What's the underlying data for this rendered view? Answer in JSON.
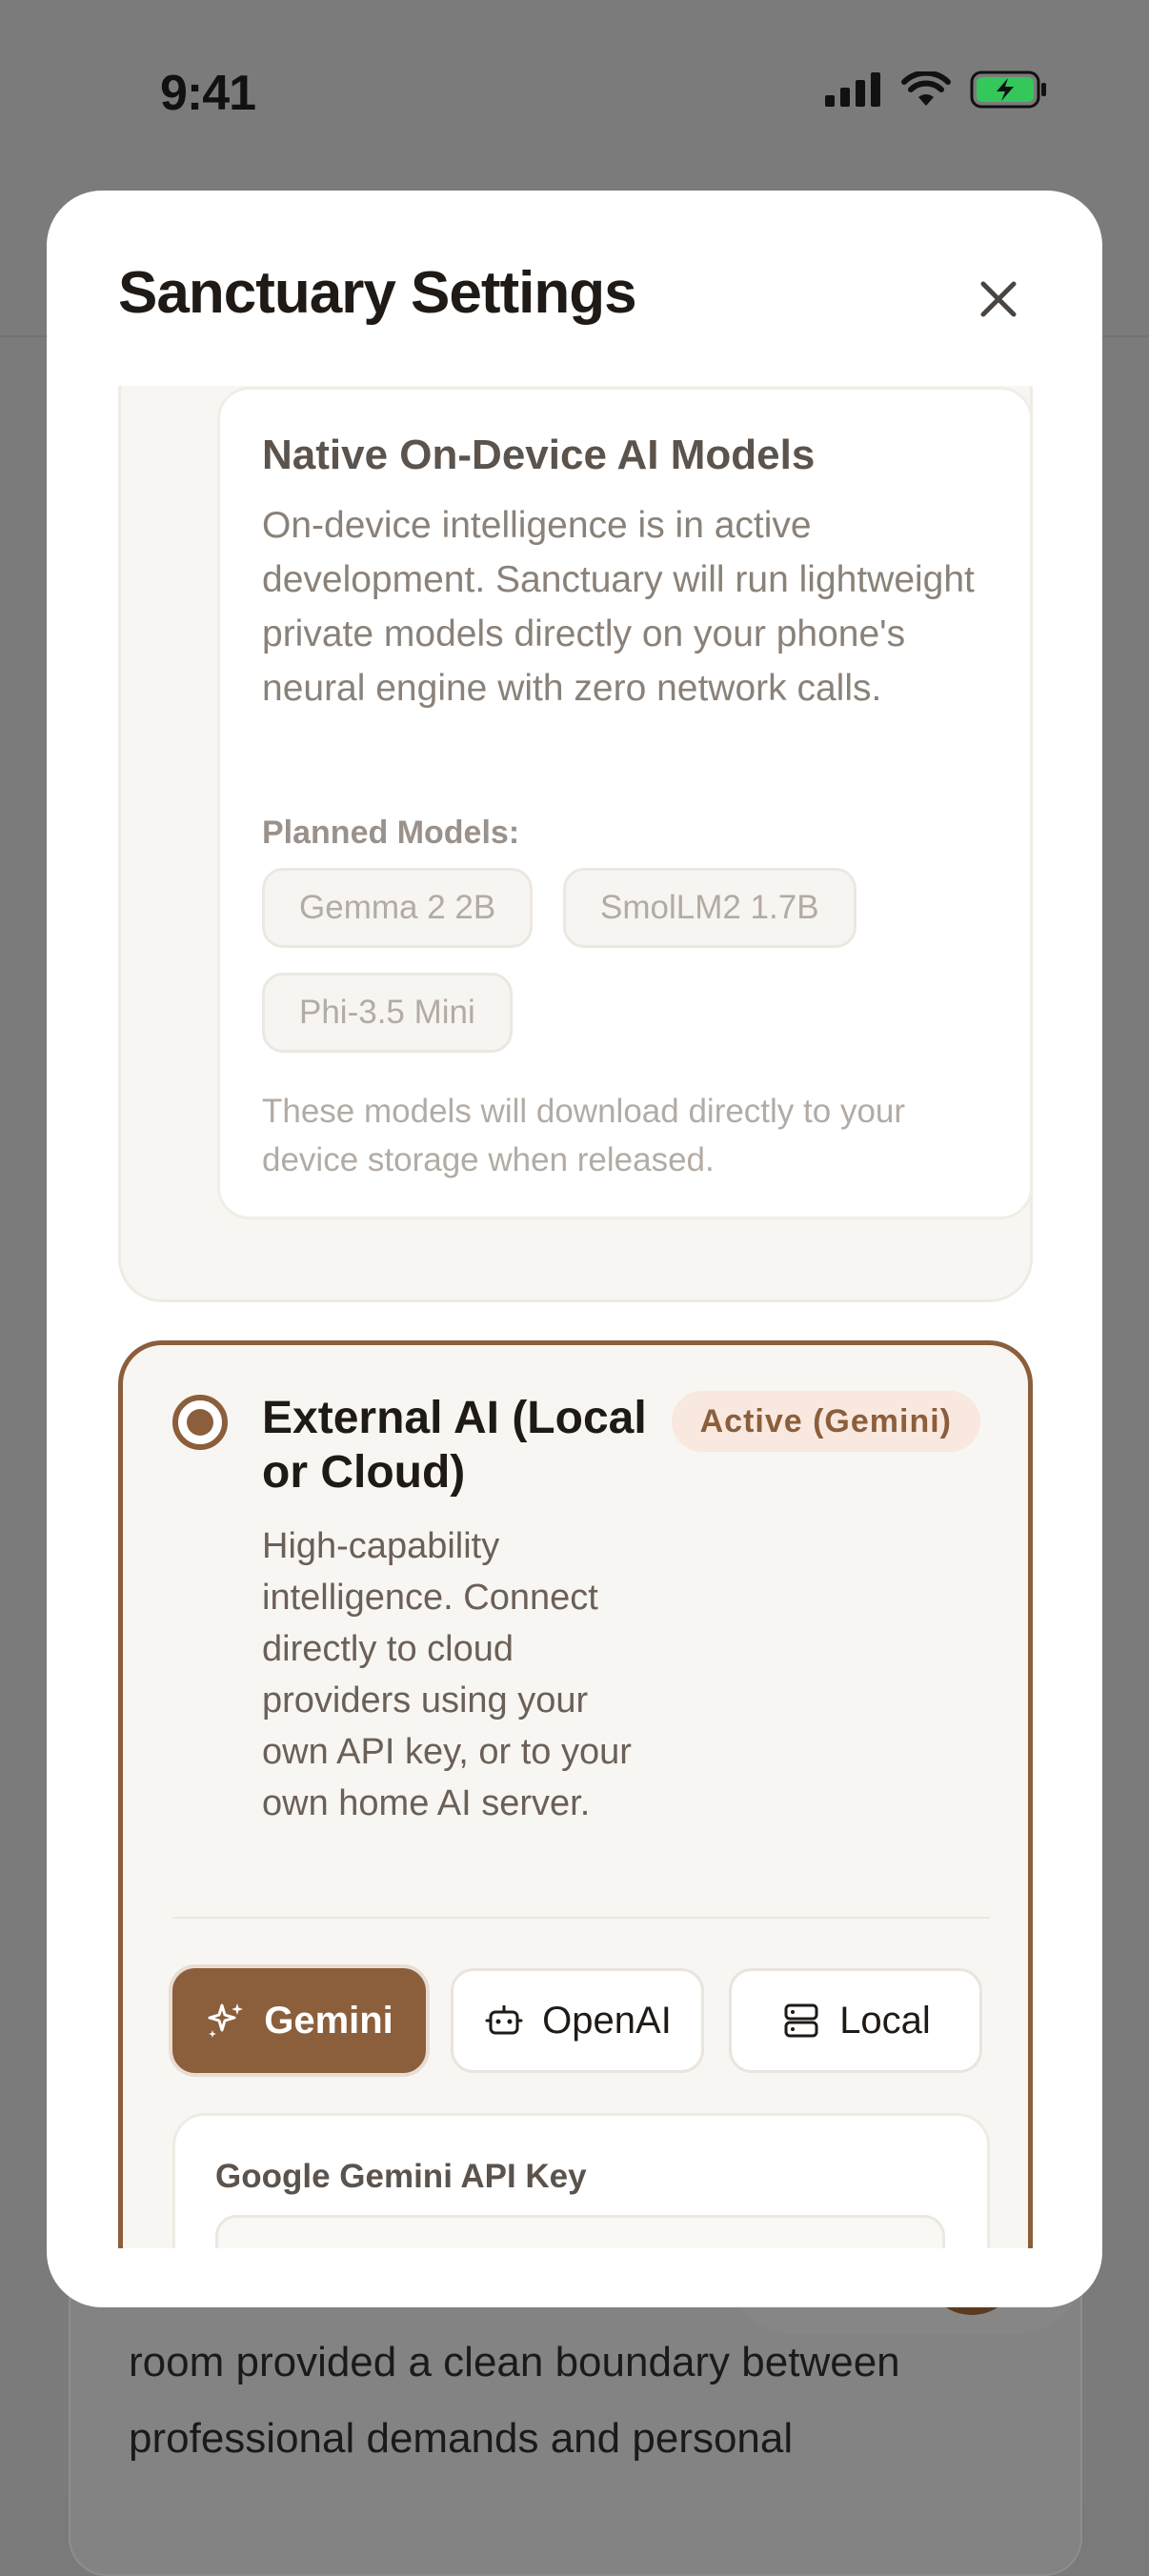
{
  "status_bar": {
    "time": "9:41"
  },
  "modal": {
    "title": "Sanctuary Settings"
  },
  "native_section": {
    "title": "Native On-Device AI Models",
    "description": "On-device intelligence is in active development. Sanctuary will run lightweight private models directly on your phone's neural engine with zero network calls.",
    "planned_label": "Planned Models:",
    "models": [
      "Gemma 2 2B",
      "SmolLM2 1.7B",
      "Phi-3.5 Mini"
    ],
    "note": "These models will download directly to your device storage when released."
  },
  "external_section": {
    "title": "External AI (Local or Cloud)",
    "badge": "Active (Gemini)",
    "description": "High-capability intelligence. Connect directly to cloud providers using your own API key, or to your own home AI server.",
    "providers": [
      {
        "label": "Gemini",
        "icon": "sparkles-icon",
        "active": true
      },
      {
        "label": "OpenAI",
        "icon": "robot-icon",
        "active": false
      },
      {
        "label": "Local",
        "icon": "server-icon",
        "active": false
      }
    ],
    "api_key_label": "Google Gemini API Key",
    "api_key_value": ""
  },
  "background_text": [
    "room provided a clean boundary between",
    "professional demands and personal"
  ],
  "colors": {
    "accent": "#8b5e3c",
    "badge_bg": "#f8e8df",
    "battery": "#34c759"
  }
}
